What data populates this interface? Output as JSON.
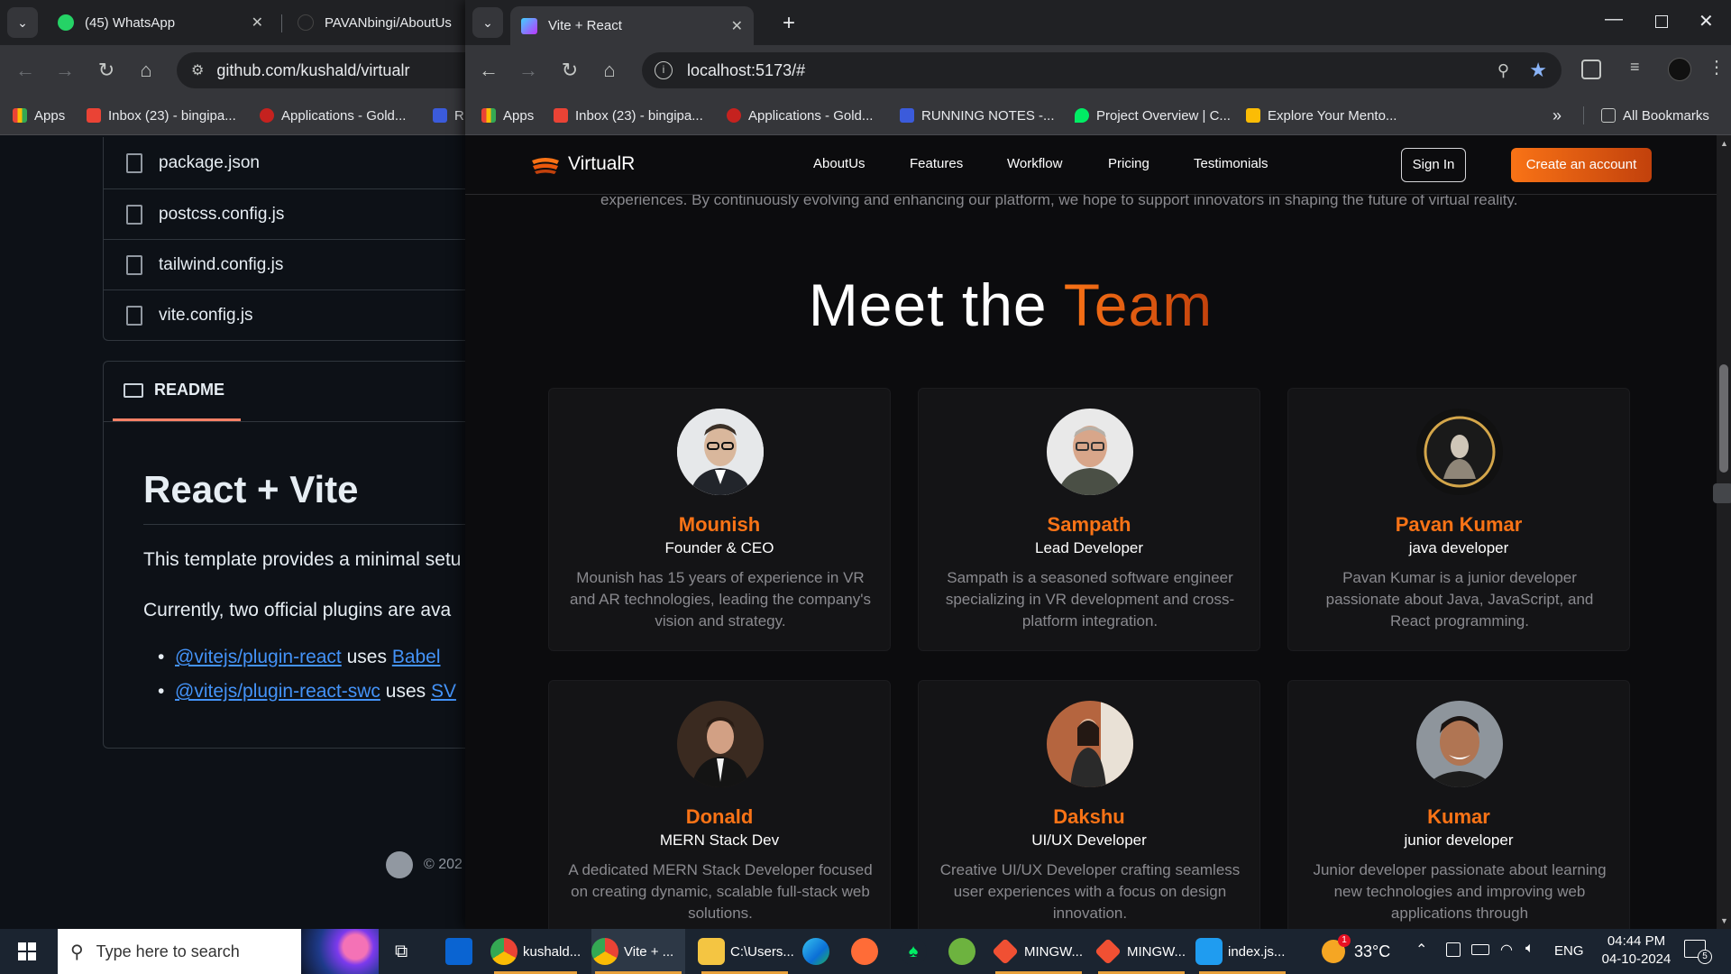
{
  "back_window": {
    "tabs": [
      {
        "label": "(45) WhatsApp",
        "badge": "45"
      },
      {
        "label": "PAVANbingi/AboutUs"
      }
    ],
    "url": "github.com/kushald/virtualr",
    "bookmarks": [
      "Apps",
      "Inbox (23) - bingipa...",
      "Applications - Gold...",
      "R"
    ],
    "files": [
      "package.json",
      "postcss.config.js",
      "tailwind.config.js",
      "vite.config.js"
    ],
    "readme_tab": "README",
    "readme_title": "React + Vite",
    "readme_p1": "This template provides a minimal setu",
    "readme_p2": "Currently, two official plugins are ava",
    "bullets": [
      {
        "link": "@vitejs/plugin-react",
        "text": "uses",
        "link2": "Babel"
      },
      {
        "link": "@vitejs/plugin-react-swc",
        "text": "uses",
        "link2": "SV"
      }
    ],
    "footer_copy": "© 202"
  },
  "front_window": {
    "active_tab": "Vite + React",
    "url": "localhost:5173/#",
    "bookmarks": [
      "Apps",
      "Inbox (23) - bingipa...",
      "Applications - Gold...",
      "RUNNING NOTES -...",
      "Project Overview | C...",
      "Explore Your Mento..."
    ],
    "all_bookmarks": "All Bookmarks"
  },
  "site": {
    "brand": "VirtualR",
    "nav": [
      "AboutUs",
      "Features",
      "Workflow",
      "Pricing",
      "Testimonials"
    ],
    "sign_in": "Sign In",
    "create_account": "Create an account",
    "intro_tail": "experiences. By continuously evolving and enhancing our platform, we hope to support innovators in shaping the future of virtual reality.",
    "heading_a": "Meet the ",
    "heading_b": "Team",
    "accent": "#f97316",
    "team": [
      {
        "name": "Mounish",
        "role": "Founder & CEO",
        "desc": "Mounish has 15 years of experience in VR and AR technologies, leading the company's vision and strategy."
      },
      {
        "name": "Sampath",
        "role": "Lead Developer",
        "desc": "Sampath is a seasoned software engineer specializing in VR development and cross-platform integration."
      },
      {
        "name": "Pavan Kumar",
        "role": "java developer",
        "desc": "Pavan Kumar is a junior developer passionate about Java, JavaScript, and React programming."
      },
      {
        "name": "Donald",
        "role": "MERN Stack Dev",
        "desc": "A dedicated MERN Stack Developer focused on creating dynamic, scalable full-stack web solutions."
      },
      {
        "name": "Dakshu",
        "role": "UI/UX Developer",
        "desc": "Creative UI/UX Developer crafting seamless user experiences with a focus on design innovation."
      },
      {
        "name": "Kumar",
        "role": "junior developer",
        "desc": "Junior developer passionate about learning new technologies and improving web applications through"
      }
    ]
  },
  "taskbar": {
    "search_placeholder": "Type here to search",
    "apps": [
      "kushald...",
      "Vite + ...",
      "C:\\Users...",
      "MINGW...",
      "MINGW...",
      "index.js..."
    ],
    "weather": "33°C",
    "weather_badge": "1",
    "lang": "ENG",
    "time": "04:44 PM",
    "date": "04-10-2024",
    "notif_count": "5"
  }
}
